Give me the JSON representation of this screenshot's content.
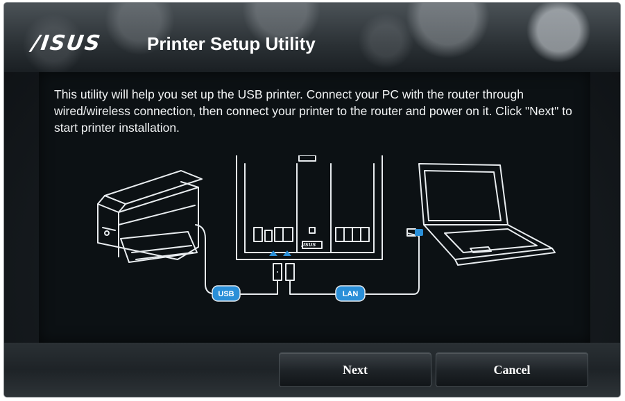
{
  "header": {
    "logo_text": "/ISUS",
    "title": "Printer Setup Utility"
  },
  "main": {
    "description": "This utility will help you set up the USB printer. Connect your PC with the router through wired/wireless connection, then connect your printer to the router and power on it. Click \"Next\" to start printer installation.",
    "diagram": {
      "usb_label": "USB",
      "lan_label": "LAN",
      "router_brand": "/ISUS",
      "accent_color": "#2a8fd8",
      "icons": [
        "printer-icon",
        "router-icon",
        "laptop-icon"
      ]
    }
  },
  "footer": {
    "next_label": "Next",
    "cancel_label": "Cancel"
  }
}
